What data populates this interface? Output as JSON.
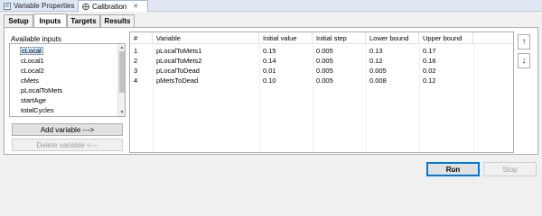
{
  "view_tabs": [
    {
      "label": "Variable Properties"
    },
    {
      "label": "Calibration"
    }
  ],
  "tabs": [
    "Setup",
    "Inputs",
    "Targets",
    "Results"
  ],
  "available_inputs": {
    "label": "Available inputs",
    "items": [
      "cLocal",
      "cLocal1",
      "cLocal2",
      "cMets",
      "pLocalToMets",
      "startAge",
      "totalCycles"
    ],
    "selected": "cLocal"
  },
  "buttons": {
    "add_variable": "Add variable --->",
    "delete_variable": "Delete variable <---",
    "run": "Run",
    "stop": "Stop",
    "move_up": "↑",
    "move_down": "↓"
  },
  "table": {
    "headers": [
      "#",
      "Variable",
      "Initial value",
      "Initial step",
      "Lower bound",
      "Upper bound"
    ],
    "rows": [
      [
        "1",
        "pLocalToMets1",
        "0.15",
        "0.005",
        "0.13",
        "0.17"
      ],
      [
        "2",
        "pLocalToMets2",
        "0.14",
        "0.005",
        "0.12",
        "0.16"
      ],
      [
        "3",
        "pLocalToDead",
        "0.01",
        "0.005",
        "0.005",
        "0.02"
      ],
      [
        "4",
        "pMetsToDead",
        "0.10",
        "0.005",
        "0.008",
        "0.12"
      ]
    ]
  }
}
